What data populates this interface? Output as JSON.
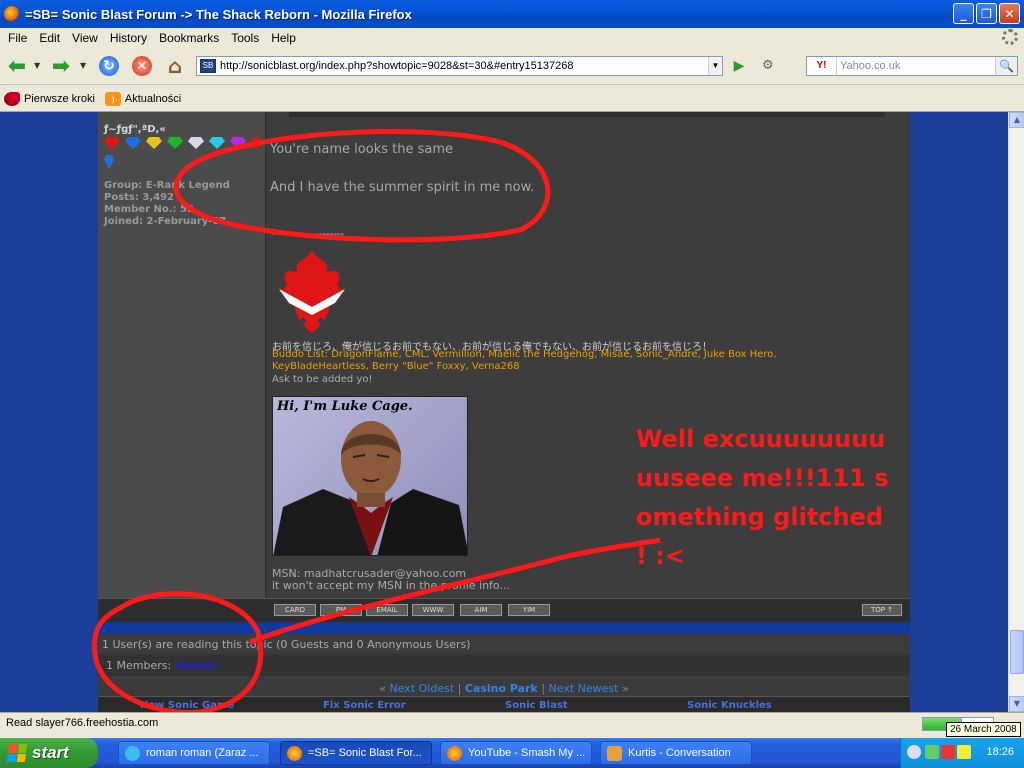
{
  "window": {
    "title": "=SB= Sonic Blast Forum -> The Shack Reborn - Mozilla Firefox",
    "controls": {
      "minimize": "_",
      "maximize": "❐",
      "close": "✕"
    }
  },
  "menu": {
    "items": [
      "File",
      "Edit",
      "View",
      "History",
      "Bookmarks",
      "Tools",
      "Help"
    ]
  },
  "toolbar": {
    "url": "http://sonicblast.org/index.php?showtopic=9028&st=30&#entry15137268",
    "search_engine": "Y!",
    "search_placeholder": "Yahoo.co.uk"
  },
  "bookmarks": {
    "items": [
      "Pierwsze kroki",
      "Aktualności"
    ]
  },
  "post": {
    "user": {
      "title": "ƒ~ƒgƒ\",ªD,«",
      "group": "Group: E-Rank Legend",
      "posts": "Posts: 3,492",
      "member_no": "Member No.: 52",
      "joined": "Joined: 2-February-07"
    },
    "message": {
      "line1": "You're name looks the same",
      "line2": "And I have the summer spirit in me now."
    },
    "signature": {
      "divider": "--------------------",
      "japanese": "お前を信じろ、俺が信じるお前でもない、お前が信じる俺でもない、お前が信じるお前を信じろ！",
      "buddo": "Buddo List: DragonFlame, CML, Vermillion, Maelic the Hedgehog, Misae, Sonic_Andre, Juke Box Hero, KeyBladeHeartless, Berry \"Blue\" Foxxy, Verna268",
      "ask": "Ask to be added yo!",
      "image_caption": "Hi, I'm Luke Cage.",
      "msn_line1": "MSN: madhatcrusader@yahoo.com",
      "msn_line2": "it won't accept my MSN in the profile info..."
    },
    "buttons": [
      "CARD",
      "PM",
      "EMAIL",
      "WWW",
      "AIM",
      "YIM"
    ],
    "top_button": "TOP ↑"
  },
  "topic_footer": {
    "readers": "1 User(s) are reading this topic (0 Guests and 0 Anonymous Users)",
    "members_label": "1 Members:",
    "member_name": "Venom",
    "nav_left_mark": "«",
    "nav_prev": "Next Oldest",
    "nav_sep": "|",
    "nav_current": "Casino Park",
    "nav_next": "Next Newest",
    "nav_right_mark": "»"
  },
  "footer_links": [
    "New Sonic Game",
    "Fix Sonic Error",
    "Sonic Blast",
    "Sonic Knuckles"
  ],
  "annotation": "Well excuuuuuuuuuuseee me!!!111 something glitched ! :<",
  "status": {
    "text": "Read slayer766.freehostia.com",
    "progress": 0.55,
    "tooltip": "26 March 2008"
  },
  "taskbar": {
    "start": "start",
    "tasks": [
      "roman roman (Zaraz ...",
      "=SB= Sonic Blast For...",
      "YouTube - Smash My ...",
      "Kurtis - Conversation"
    ],
    "clock": "18:26"
  },
  "colors": {
    "titlebar": "#0754d6",
    "page_blue": "#1a3e9a",
    "forum_gray": "#3b3b3b",
    "signature_orange": "#e8a000",
    "annotation_red": "#ff1a1a",
    "link_blue": "#3a82e8"
  }
}
